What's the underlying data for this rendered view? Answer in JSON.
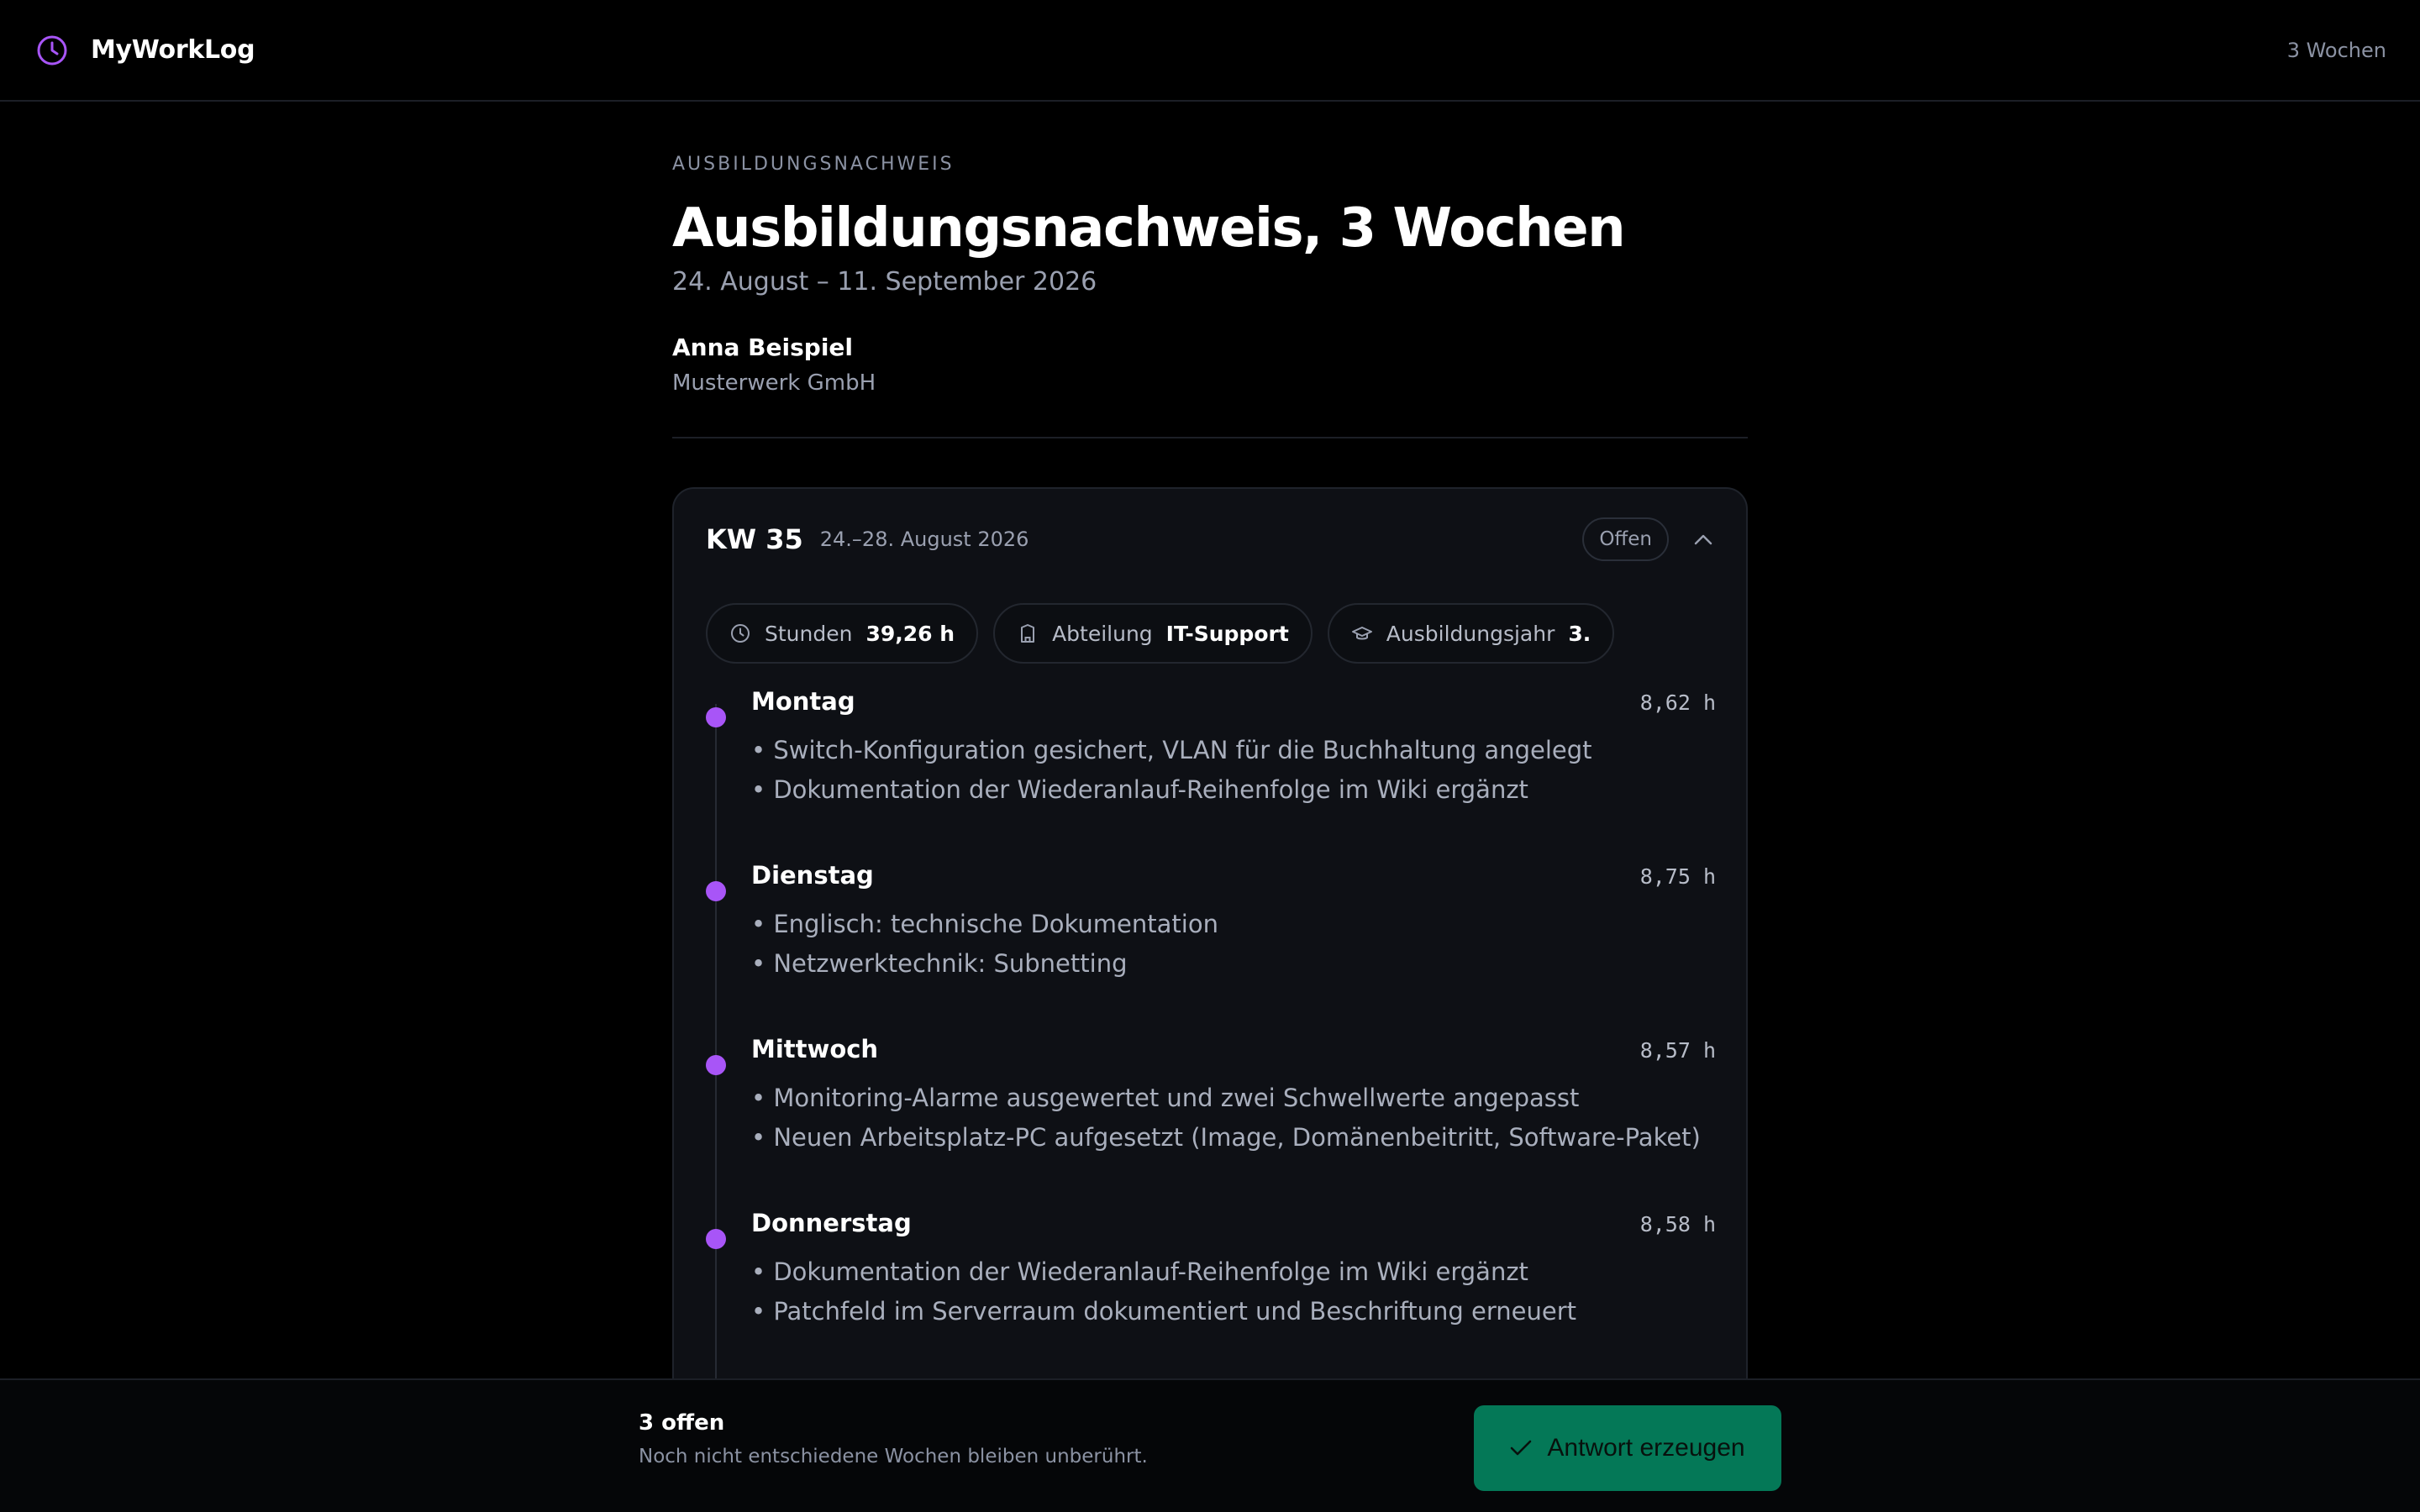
{
  "app": {
    "name": "MyWorkLog",
    "period_label": "3 Wochen"
  },
  "header": {
    "eyebrow": "AUSBILDUNGSNACHWEIS",
    "title": "Ausbildungsnachweis, 3 Wochen",
    "date_range": "24. August – 11. September 2026",
    "person_name": "Anna Beispiel",
    "company": "Musterwerk GmbH"
  },
  "week": {
    "kw": "KW 35",
    "dates": "24.–28. August 2026",
    "status": "Offen",
    "chips": {
      "hours_label": "Stunden",
      "hours_value": "39,26 h",
      "department_label": "Abteilung",
      "department_value": "IT-Support",
      "year_label": "Ausbildungsjahr",
      "year_value": "3."
    },
    "days": [
      {
        "name": "Montag",
        "hours": "8,62 h",
        "tasks": [
          "• Switch-Konfiguration gesichert, VLAN für die Buchhaltung angelegt",
          "• Dokumentation der Wiederanlauf-Reihenfolge im Wiki ergänzt"
        ]
      },
      {
        "name": "Dienstag",
        "hours": "8,75 h",
        "tasks": [
          "• Englisch: technische Dokumentation",
          "• Netzwerktechnik: Subnetting"
        ]
      },
      {
        "name": "Mittwoch",
        "hours": "8,57 h",
        "tasks": [
          "• Monitoring-Alarme ausgewertet und zwei Schwellwerte angepasst",
          "• Neuen Arbeitsplatz-PC aufgesetzt (Image, Domänenbeitritt, Software-Paket)"
        ]
      },
      {
        "name": "Donnerstag",
        "hours": "8,58 h",
        "tasks": [
          "• Dokumentation der Wiederanlauf-Reihenfolge im Wiki ergänzt",
          "• Patchfeld im Serverraum dokumentiert und Beschriftung erneuert"
        ]
      }
    ]
  },
  "footer": {
    "open_count": "3 offen",
    "note": "Noch nicht entschiedene Wochen bleiben unberührt.",
    "action_label": "Antwort erzeugen"
  },
  "colors": {
    "accent": "#a855f7",
    "primary_button": "#047857",
    "background": "#000000",
    "card": "#0e1015"
  },
  "icons": {
    "brand": "clock-icon",
    "hours": "clock-icon",
    "department": "building-icon",
    "year": "graduation-cap-icon",
    "collapse": "chevron-up-icon",
    "action": "check-icon"
  }
}
